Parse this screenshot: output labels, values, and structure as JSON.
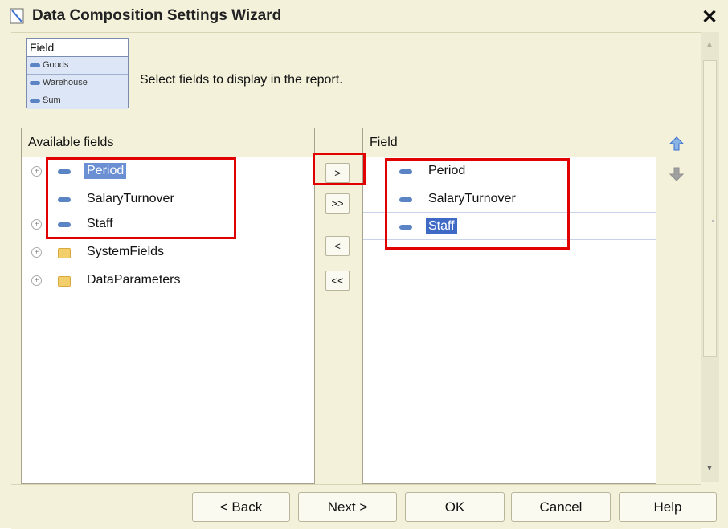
{
  "window": {
    "title": "Data Composition Settings Wizard",
    "close_label": "✕"
  },
  "header": {
    "instruction": "Select fields to display in the report.",
    "badge": {
      "title": "Field",
      "rows": [
        "Goods",
        "Warehouse",
        "Sum"
      ]
    }
  },
  "available": {
    "header": "Available fields",
    "items": [
      {
        "label": "Period",
        "type": "field",
        "expandable": true,
        "selected": true
      },
      {
        "label": "SalaryTurnover",
        "type": "field",
        "expandable": false,
        "selected": false
      },
      {
        "label": "Staff",
        "type": "field",
        "expandable": true,
        "selected": false
      },
      {
        "label": "SystemFields",
        "type": "folder",
        "expandable": true,
        "selected": false
      },
      {
        "label": "DataParameters",
        "type": "folder",
        "expandable": true,
        "selected": false
      }
    ]
  },
  "move_buttons": {
    "add": ">",
    "add_all": ">>",
    "remove": "<",
    "remove_all": "<<"
  },
  "selected": {
    "header": "Field",
    "items": [
      {
        "label": "Period",
        "selected": false
      },
      {
        "label": "SalaryTurnover",
        "selected": false
      },
      {
        "label": "Staff",
        "selected": true
      }
    ]
  },
  "footer": {
    "back": "< Back",
    "next": "Next >",
    "ok": "OK",
    "cancel": "Cancel",
    "help": "Help"
  },
  "colors": {
    "highlight": "#e00000",
    "selection": "#6b8fd3",
    "background": "#f4f1da"
  }
}
